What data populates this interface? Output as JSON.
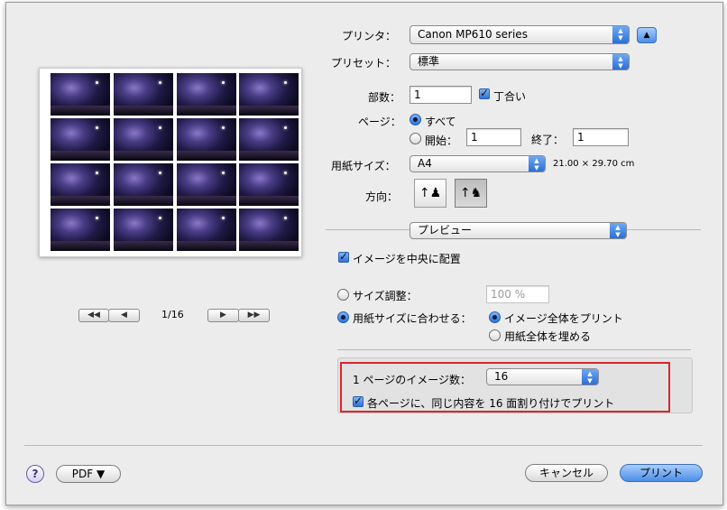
{
  "printer": {
    "label": "プリンタ：",
    "value": "Canon MP610 series"
  },
  "preset": {
    "label": "プリセット：",
    "value": "標準"
  },
  "copies": {
    "label": "部数：",
    "value": "1",
    "collate_label": "丁合い",
    "collate_checked": true
  },
  "pages": {
    "label": "ページ：",
    "all_label": "すべて",
    "from_label": "開始：",
    "from_value": "1",
    "to_label": "終了：",
    "to_value": "1",
    "selected": "all"
  },
  "paper": {
    "label": "用紙サイズ：",
    "value": "A4",
    "dims": "21.00 × 29.70 cm"
  },
  "orientation": {
    "label": "方向："
  },
  "section_popup": {
    "value": "プレビュー"
  },
  "center_image": {
    "label": "イメージを中央に配置",
    "checked": true
  },
  "scale": {
    "label": "サイズ調整：",
    "value": "100 %"
  },
  "fit": {
    "label": "用紙サイズに合わせる：",
    "option_whole": "イメージ全体をプリント",
    "option_fill": "用紙全体を埋める"
  },
  "images_per_page": {
    "label": "1 ページのイメージ数：",
    "value": "16"
  },
  "repeat": {
    "label": "各ページに、同じ内容を 16 面割り付けでプリント",
    "checked": true
  },
  "preview_nav": {
    "page": "1/16",
    "first": "◀◀",
    "prev": "◀",
    "next": "▶",
    "last": "▶▶"
  },
  "bottom": {
    "help": "?",
    "pdf": "PDF ▼",
    "cancel": "キャンセル",
    "print": "プリント"
  },
  "colors": {
    "accent": "#2f73d8",
    "highlight_box": "#d7262e"
  }
}
